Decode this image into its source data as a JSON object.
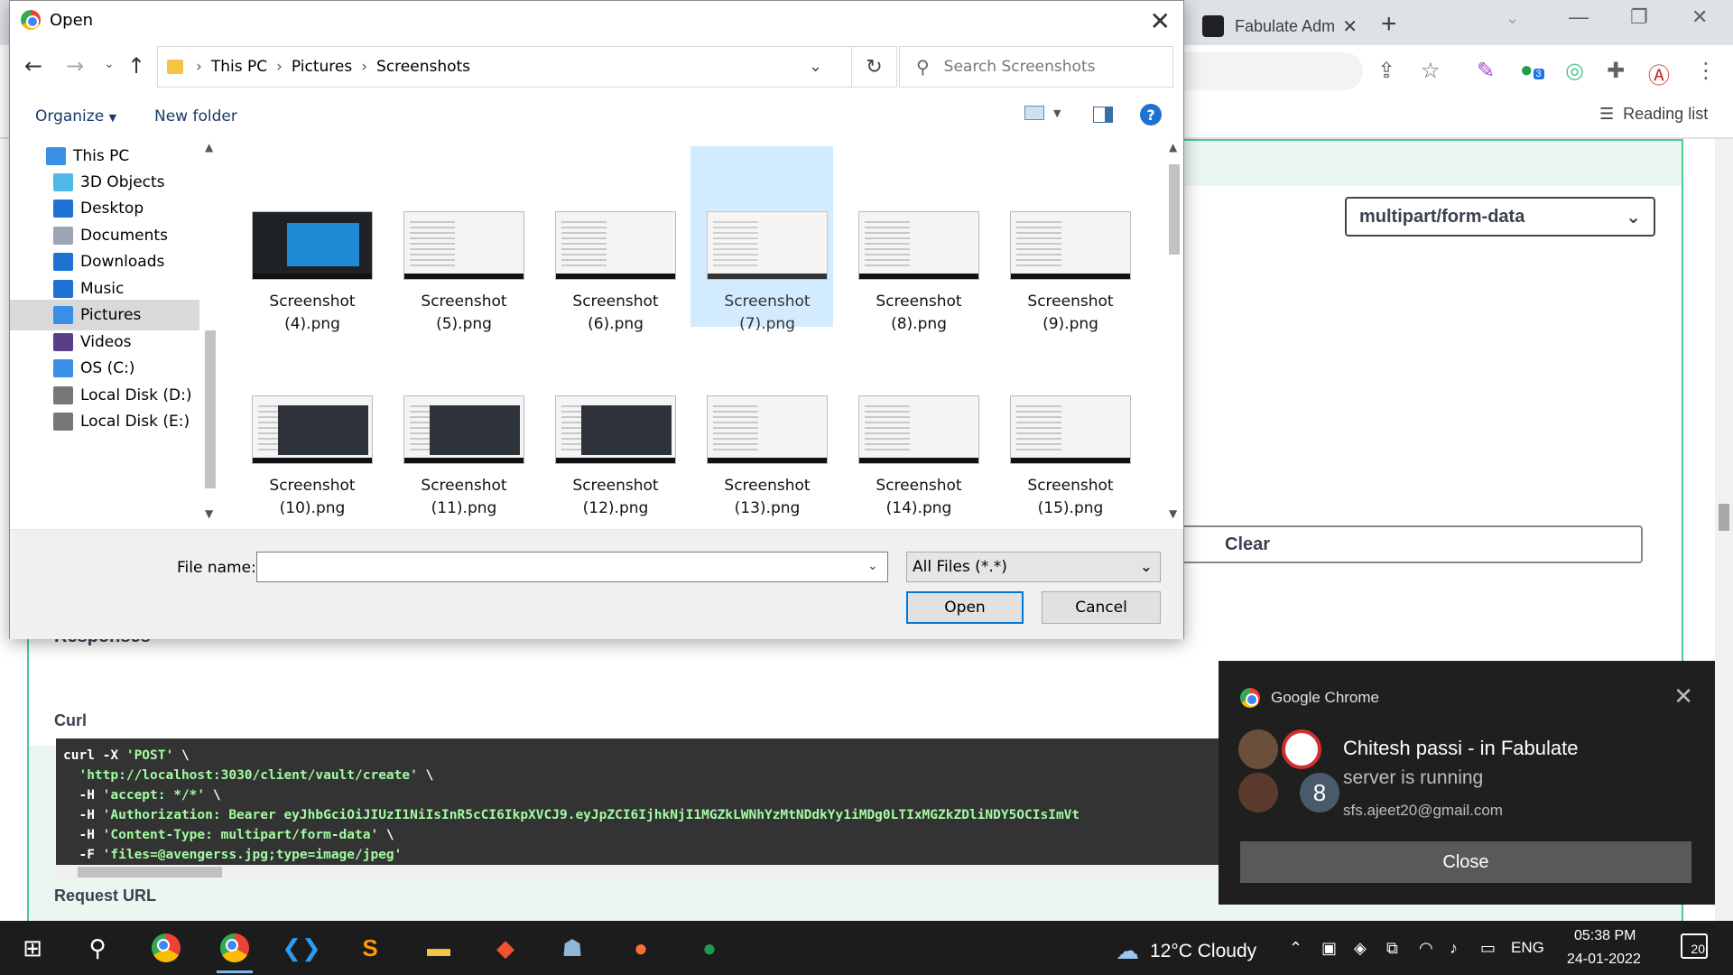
{
  "browser": {
    "tab_title": "Fabulate Adm",
    "reading_list": "Reading list",
    "extension_badge": "3"
  },
  "page": {
    "content_type": "multipart/form-data",
    "clear_label": "Clear",
    "responses_heading": "Responses",
    "curl_label": "Curl",
    "curl_lines": [
      "curl -X 'POST' \\",
      "  'http://localhost:3030/client/vault/create' \\",
      "  -H 'accept: */*' \\",
      "  -H 'Authorization: Bearer eyJhbGciOiJIUzI1NiIsInR5cCI6IkpXVCJ9.eyJpZCI6IjhkNjI1MGZkLWNhYzMtNDdkYy1iMDg0LTIxMGZkZDliNDY5OCIsImVt",
      "  -H 'Content-Type: multipart/form-data' \\",
      "  -F 'files=@avengerss.jpg;type=image/jpeg'"
    ],
    "request_url_label": "Request URL"
  },
  "dialog": {
    "title": "Open",
    "breadcrumb": [
      "This PC",
      "Pictures",
      "Screenshots"
    ],
    "search_placeholder": "Search Screenshots",
    "organize_label": "Organize",
    "new_folder_label": "New folder",
    "help_label": "?",
    "nav_items": [
      {
        "label": "This PC",
        "icon": "monitor-icon",
        "color": "#3a8ee6"
      },
      {
        "label": "3D Objects",
        "icon": "cube-icon",
        "color": "#4fb8e8"
      },
      {
        "label": "Desktop",
        "icon": "desktop-icon",
        "color": "#1e73d2"
      },
      {
        "label": "Documents",
        "icon": "document-icon",
        "color": "#9aa6b2"
      },
      {
        "label": "Downloads",
        "icon": "download-icon",
        "color": "#1e73d2"
      },
      {
        "label": "Music",
        "icon": "music-icon",
        "color": "#1e73d2"
      },
      {
        "label": "Pictures",
        "icon": "pictures-icon",
        "color": "#3a8ee6"
      },
      {
        "label": "Videos",
        "icon": "video-icon",
        "color": "#5a3e8c"
      },
      {
        "label": "OS (C:)",
        "icon": "drive-icon",
        "color": "#3a8ee6"
      },
      {
        "label": "Local Disk (D:)",
        "icon": "drive-icon",
        "color": "#777777"
      },
      {
        "label": "Local Disk (E:)",
        "icon": "drive-icon",
        "color": "#777777"
      }
    ],
    "selected_nav": "Pictures",
    "files": [
      {
        "name": "Screenshot (4).png",
        "line1": "Screenshot",
        "line2": "(4).png",
        "style": "dark-blue"
      },
      {
        "name": "Screenshot (5).png",
        "line1": "Screenshot",
        "line2": "(5).png",
        "style": "light"
      },
      {
        "name": "Screenshot (6).png",
        "line1": "Screenshot",
        "line2": "(6).png",
        "style": "light"
      },
      {
        "name": "Screenshot (7).png",
        "line1": "Screenshot",
        "line2": "(7).png",
        "style": "light"
      },
      {
        "name": "Screenshot (8).png",
        "line1": "Screenshot",
        "line2": "(8).png",
        "style": "light"
      },
      {
        "name": "Screenshot (9).png",
        "line1": "Screenshot",
        "line2": "(9).png",
        "style": "light"
      },
      {
        "name": "Screenshot (10).png",
        "line1": "Screenshot",
        "line2": "(10).png",
        "style": "dark"
      },
      {
        "name": "Screenshot (11).png",
        "line1": "Screenshot",
        "line2": "(11).png",
        "style": "dark"
      },
      {
        "name": "Screenshot (12).png",
        "line1": "Screenshot",
        "line2": "(12).png",
        "style": "dark"
      },
      {
        "name": "Screenshot (13).png",
        "line1": "Screenshot",
        "line2": "(13).png",
        "style": "light"
      },
      {
        "name": "Screenshot (14).png",
        "line1": "Screenshot",
        "line2": "(14).png",
        "style": "light"
      },
      {
        "name": "Screenshot (15).png",
        "line1": "Screenshot",
        "line2": "(15).png",
        "style": "light"
      }
    ],
    "selected_file": "Screenshot (7).png",
    "file_name_label": "File name:",
    "file_name_value": "",
    "file_type": "All Files (*.*)",
    "open_label": "Open",
    "cancel_label": "Cancel"
  },
  "notification": {
    "app": "Google Chrome",
    "title": "Chitesh passi - in Fabulate",
    "body": "server is running",
    "email": "sfs.ajeet20@gmail.com",
    "count": "8",
    "close_label": "Close"
  },
  "taskbar": {
    "weather": "12°C  Cloudy",
    "language": "ENG",
    "time": "05:38 PM",
    "date": "24-01-2022",
    "notification_count": "20"
  },
  "colors": {
    "accent": "#0078d7",
    "swagger_green": "#49cc90",
    "selection": "#cce8ff"
  }
}
